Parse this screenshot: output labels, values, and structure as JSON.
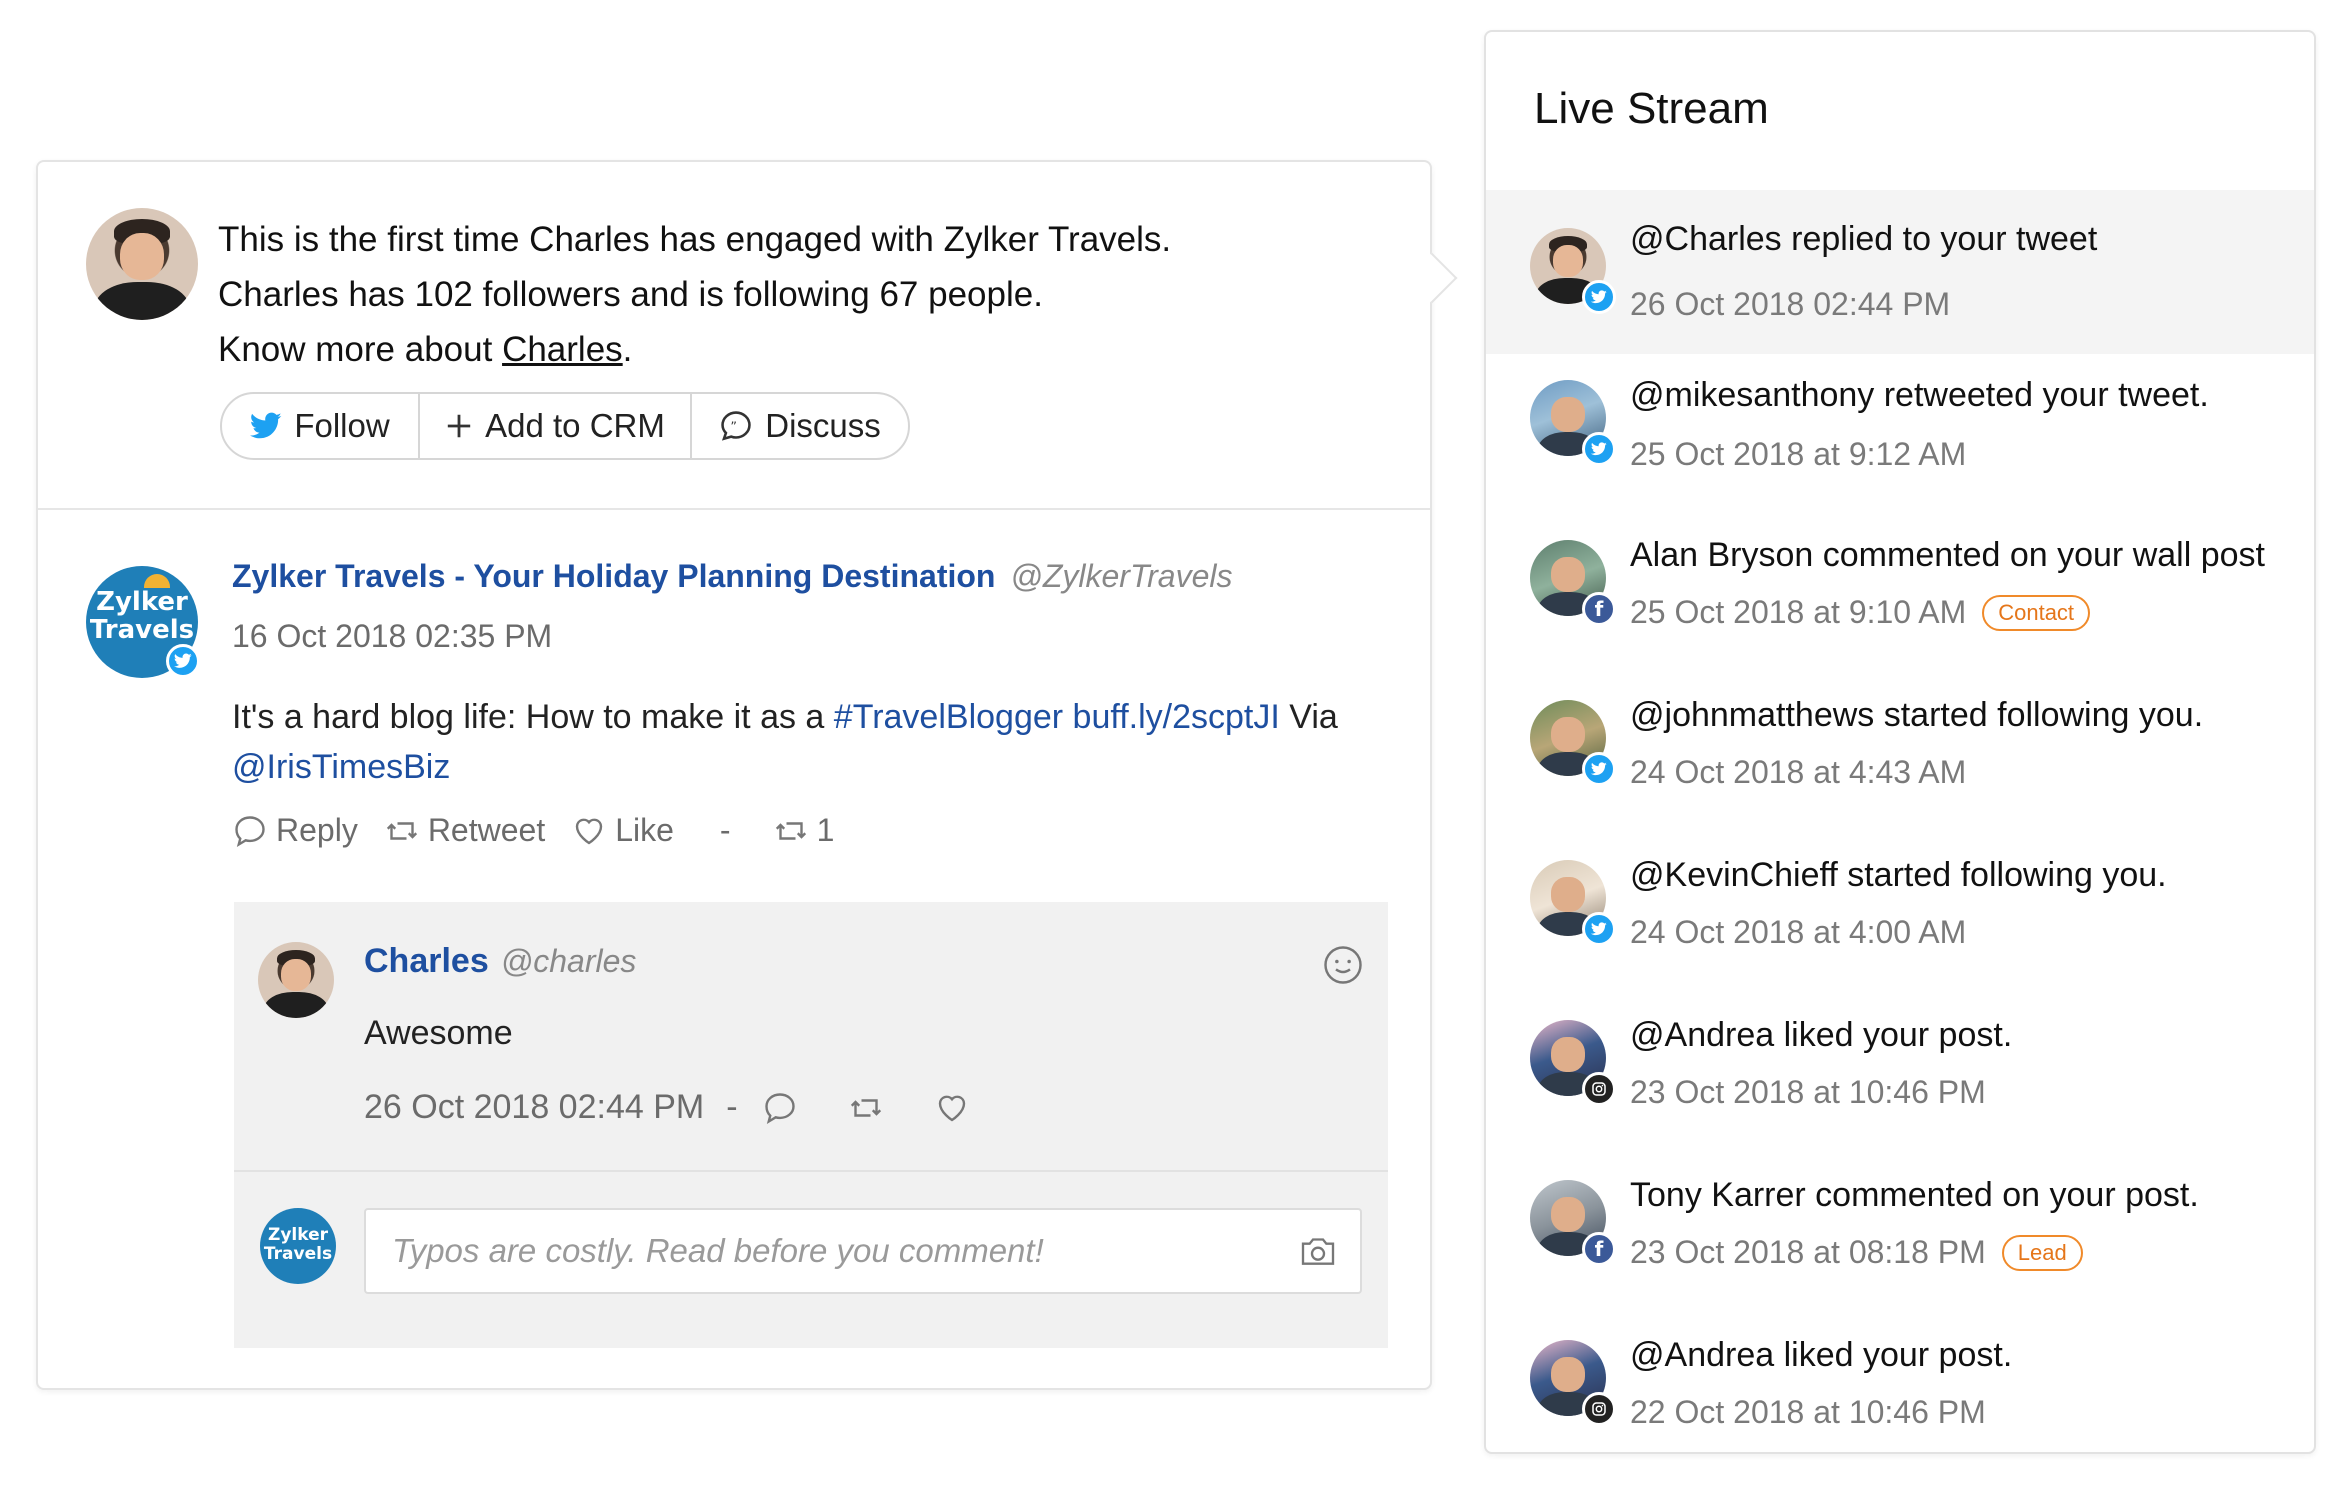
{
  "engagement": {
    "line1": "This is the first time Charles has engaged with Zylker Travels.",
    "line2": "Charles has 102 followers and is following 67 people.",
    "line3_prefix": "Know more about ",
    "line3_link": "Charles",
    "line3_suffix": ".",
    "actions": {
      "follow": "Follow",
      "add_to_crm": "Add to CRM",
      "discuss": "Discuss"
    }
  },
  "post": {
    "author_name": "Zylker Travels - Your Holiday Planning Destination",
    "author_handle": "@ZylkerTravels",
    "logo_text_1": "Zylker",
    "logo_text_2": "Travels",
    "timestamp": "16 Oct 2018 02:35 PM",
    "body_prefix": "It's a hard blog life: How to make it as a ",
    "hashtag": "#TravelBlogger",
    "link": "buff.ly/2scptJI",
    "body_via": " Via",
    "mention": "@IrisTimesBiz",
    "actions": {
      "reply": "Reply",
      "retweet": "Retweet",
      "like": "Like",
      "separator": "-",
      "retweet_count": "1"
    }
  },
  "reply": {
    "name": "Charles",
    "handle": "@charles",
    "text": "Awesome",
    "timestamp": "26 Oct 2018 02:44 PM",
    "separator": "-"
  },
  "comment": {
    "placeholder": "Typos are costly. Read before you comment!"
  },
  "live_stream": {
    "title": "Live Stream",
    "items": [
      {
        "text": "@Charles replied to your tweet",
        "time": "26 Oct 2018 02:44 PM",
        "network": "twitter",
        "tag": ""
      },
      {
        "text": "@mikesanthony retweeted your tweet.",
        "time": "25 Oct 2018 at 9:12 AM",
        "network": "twitter",
        "tag": ""
      },
      {
        "text": "Alan Bryson commented on your wall post",
        "time": "25 Oct 2018 at 9:10 AM",
        "network": "facebook",
        "tag": "Contact"
      },
      {
        "text": "@johnmatthews started following you.",
        "time": "24 Oct 2018 at 4:43 AM",
        "network": "twitter",
        "tag": ""
      },
      {
        "text": "@KevinChieff started following you.",
        "time": "24 Oct 2018 at 4:00 AM",
        "network": "twitter",
        "tag": ""
      },
      {
        "text": "@Andrea liked your post.",
        "time": "23 Oct 2018 at 10:46 PM",
        "network": "instagram",
        "tag": ""
      },
      {
        "text": "Tony Karrer commented on your post.",
        "time": "23 Oct 2018 at 08:18 PM",
        "network": "facebook",
        "tag": "Lead"
      },
      {
        "text": "@Andrea liked your post.",
        "time": "22 Oct 2018 at 10:46 PM",
        "network": "instagram",
        "tag": ""
      }
    ]
  },
  "colors": {
    "link_blue": "#1e4fa0",
    "twitter_blue": "#1da1f2",
    "facebook_blue": "#3b5998",
    "tag_orange": "#f08a2a",
    "reply_bg": "#f1f1f1",
    "active_item_bg": "#f4f4f4"
  }
}
